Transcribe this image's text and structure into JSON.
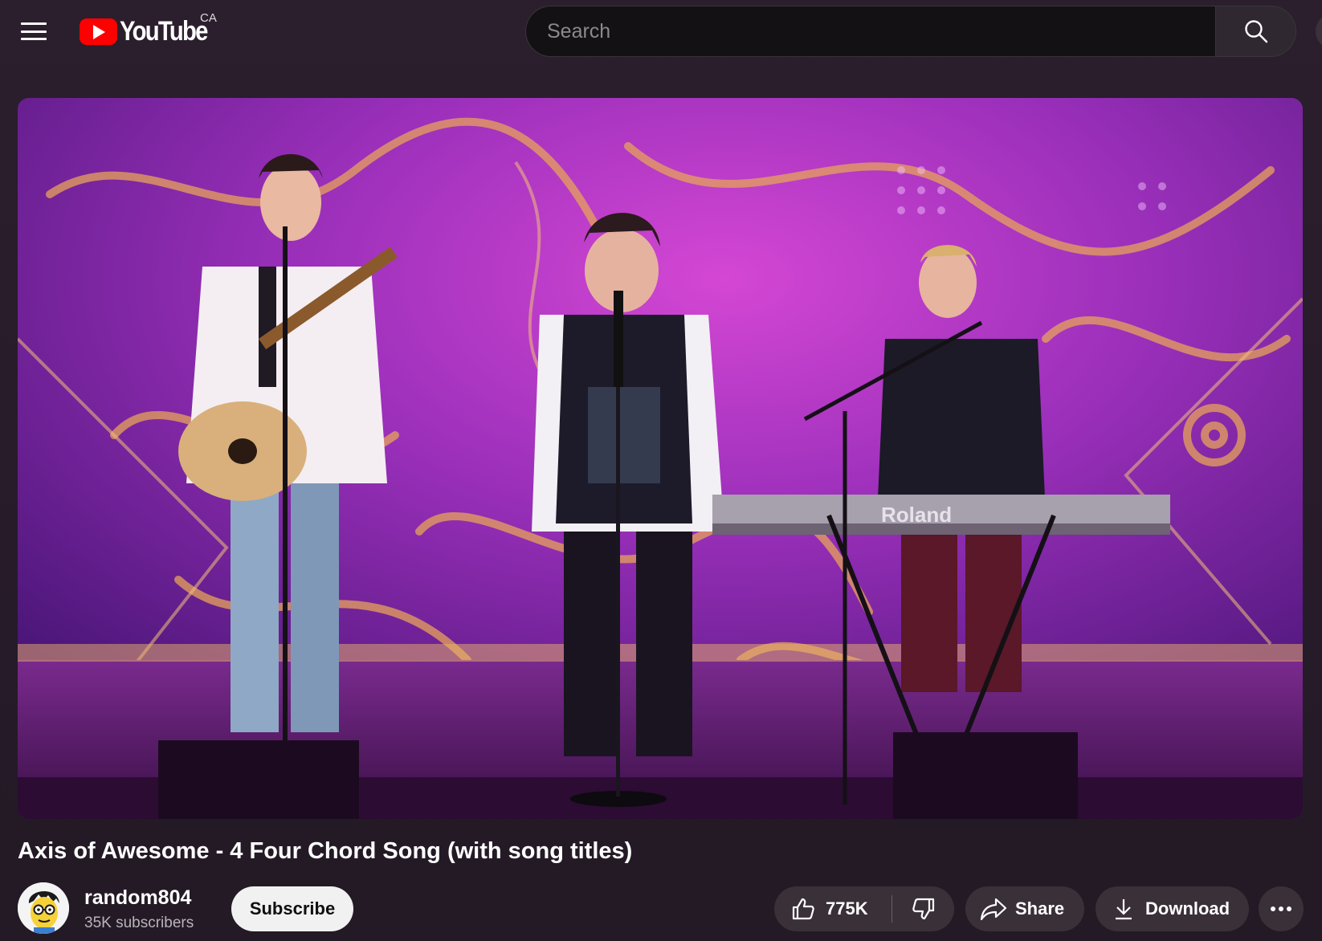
{
  "header": {
    "logo_text": "YouTube",
    "region": "CA",
    "search_placeholder": "Search"
  },
  "video": {
    "title": "Axis of Awesome - 4 Four Chord Song (with song titles)"
  },
  "channel": {
    "name": "random804",
    "subscribers": "35K subscribers",
    "subscribe_label": "Subscribe"
  },
  "actions": {
    "likes": "775K",
    "share_label": "Share",
    "download_label": "Download"
  },
  "player_scene": {
    "keyboard_brand": "Roland"
  },
  "colors": {
    "brand_red": "#ff0000",
    "background": "#2b1e2d",
    "pill": "#3a3038"
  }
}
